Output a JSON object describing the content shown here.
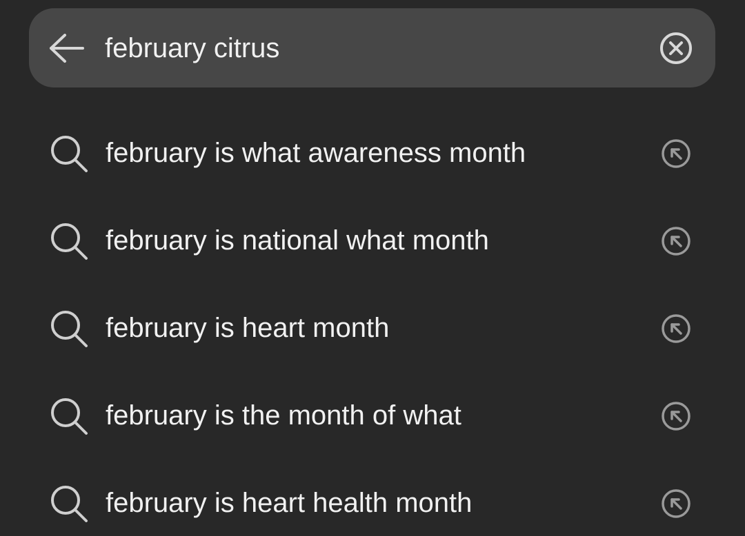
{
  "search": {
    "value": "february citrus",
    "back_icon": "arrow-left-icon",
    "clear_icon": "clear-circle-icon"
  },
  "suggestions": [
    {
      "text": "february is what awareness month",
      "icon": "search-icon",
      "action_icon": "fill-query-arrow-icon"
    },
    {
      "text": "february is national what month",
      "icon": "search-icon",
      "action_icon": "fill-query-arrow-icon"
    },
    {
      "text": "february is heart month",
      "icon": "search-icon",
      "action_icon": "fill-query-arrow-icon"
    },
    {
      "text": "february is the month of what",
      "icon": "search-icon",
      "action_icon": "fill-query-arrow-icon"
    },
    {
      "text": "february is heart health month",
      "icon": "search-icon",
      "action_icon": "fill-query-arrow-icon"
    }
  ],
  "colors": {
    "background": "#282828",
    "search_bar": "#474747",
    "text": "#f1f1f1",
    "icon": "#cfcfcf",
    "action_icon": "#9a9a9a"
  }
}
